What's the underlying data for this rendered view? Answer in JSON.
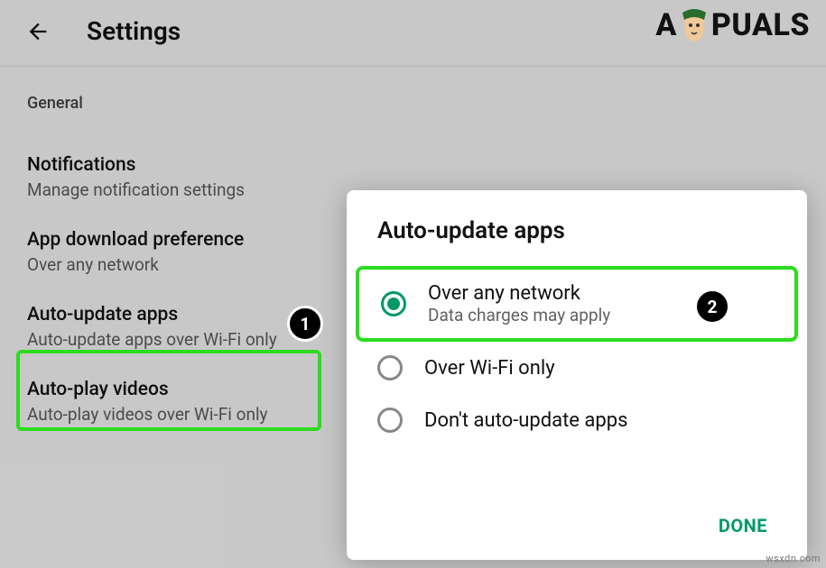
{
  "header": {
    "title": "Settings"
  },
  "logo": {
    "prefix": "A",
    "suffix": "PUALS"
  },
  "section_label": "General",
  "settings": {
    "notifications": {
      "title": "Notifications",
      "sub": "Manage notification settings"
    },
    "download_pref": {
      "title": "App download preference",
      "sub": "Over any network"
    },
    "auto_update": {
      "title": "Auto-update apps",
      "sub": "Auto-update apps over Wi-Fi only"
    },
    "auto_play": {
      "title": "Auto-play videos",
      "sub": "Auto-play videos over Wi-Fi only"
    }
  },
  "dialog": {
    "title": "Auto-update apps",
    "options": {
      "any_network": {
        "title": "Over any network",
        "sub": "Data charges may apply"
      },
      "wifi_only": {
        "title": "Over Wi-Fi only"
      },
      "dont_update": {
        "title": "Don't auto-update apps"
      }
    },
    "done": "DONE"
  },
  "badges": {
    "one": "1",
    "two": "2"
  },
  "watermark": "wsxdn.com"
}
